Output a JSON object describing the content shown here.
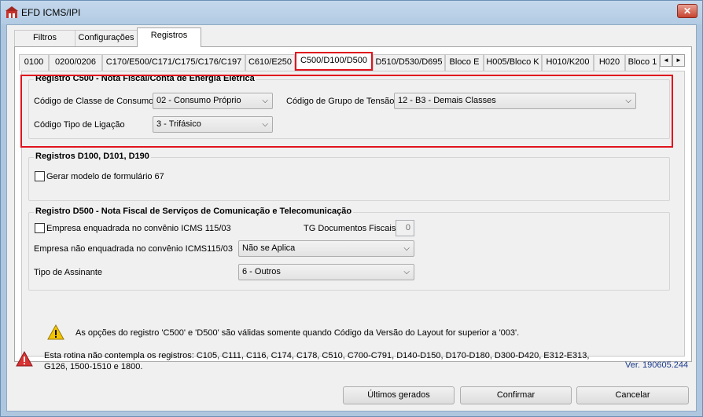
{
  "window": {
    "title": "EFD ICMS/IPI",
    "close_label": "✕"
  },
  "top_tabs": [
    {
      "label": "Filtros"
    },
    {
      "label": "Configurações"
    },
    {
      "label": "Registros"
    }
  ],
  "sub_tabs": [
    {
      "label": "0100"
    },
    {
      "label": "0200/0206"
    },
    {
      "label": "C170/E500/C171/C175/C176/C197"
    },
    {
      "label": "C610/E250"
    },
    {
      "label": "C500/D100/D500"
    },
    {
      "label": "D510/D530/D695"
    },
    {
      "label": "Bloco E"
    },
    {
      "label": "H005/Bloco K"
    },
    {
      "label": "H010/K200"
    },
    {
      "label": "H020"
    },
    {
      "label": "Bloco 1"
    }
  ],
  "c500": {
    "title": "Registro C500 - Nota Fiscal/Conta de Energia Elétrica",
    "classe_label": "Código de Classe de Consumo",
    "classe_value": "02 - Consumo Próprio",
    "grupo_label": "Código de Grupo de Tensão",
    "grupo_value": "12 - B3 - Demais Classes",
    "ligacao_label": "Código Tipo de Ligação",
    "ligacao_value": "3 - Trifásico"
  },
  "d100": {
    "title": "Registros D100, D101, D190",
    "gerar_label": "Gerar modelo de formulário 67"
  },
  "d500": {
    "title": "Registro D500 - Nota Fiscal de Serviços de Comunicação e Telecomunicação",
    "enquadrada_label": "Empresa enquadrada no convênio ICMS 115/03",
    "tg_label": "TG Documentos Fiscais",
    "tg_value": "0",
    "nao_enquadrada_label": "Empresa não enquadrada no convênio ICMS115/03",
    "nao_enquadrada_value": "Não se Aplica",
    "assinante_label": "Tipo de Assinante",
    "assinante_value": "6 - Outros"
  },
  "warning_note": "As opções do registro 'C500' e 'D500' são válidas somente quando Código da Versão do Layout for superior a '003'.",
  "footer": {
    "info_line1": "Esta rotina não contempla os registros: C105, C111, C116, C174, C178, C510, C700-C791, D140-D150, D170-D180, D300-D420, E312-E313,",
    "info_line2": "G126, 1500-1510 e 1800.",
    "version": "Ver. 190605.244"
  },
  "buttons": {
    "ultimos": "Últimos gerados",
    "confirmar": "Confirmar",
    "cancelar": "Cancelar"
  },
  "colors": {
    "highlight": "#e0141e",
    "version_text": "#1a3a8c",
    "warning_triangle": "#f5c400",
    "error_triangle": "#d83232"
  }
}
